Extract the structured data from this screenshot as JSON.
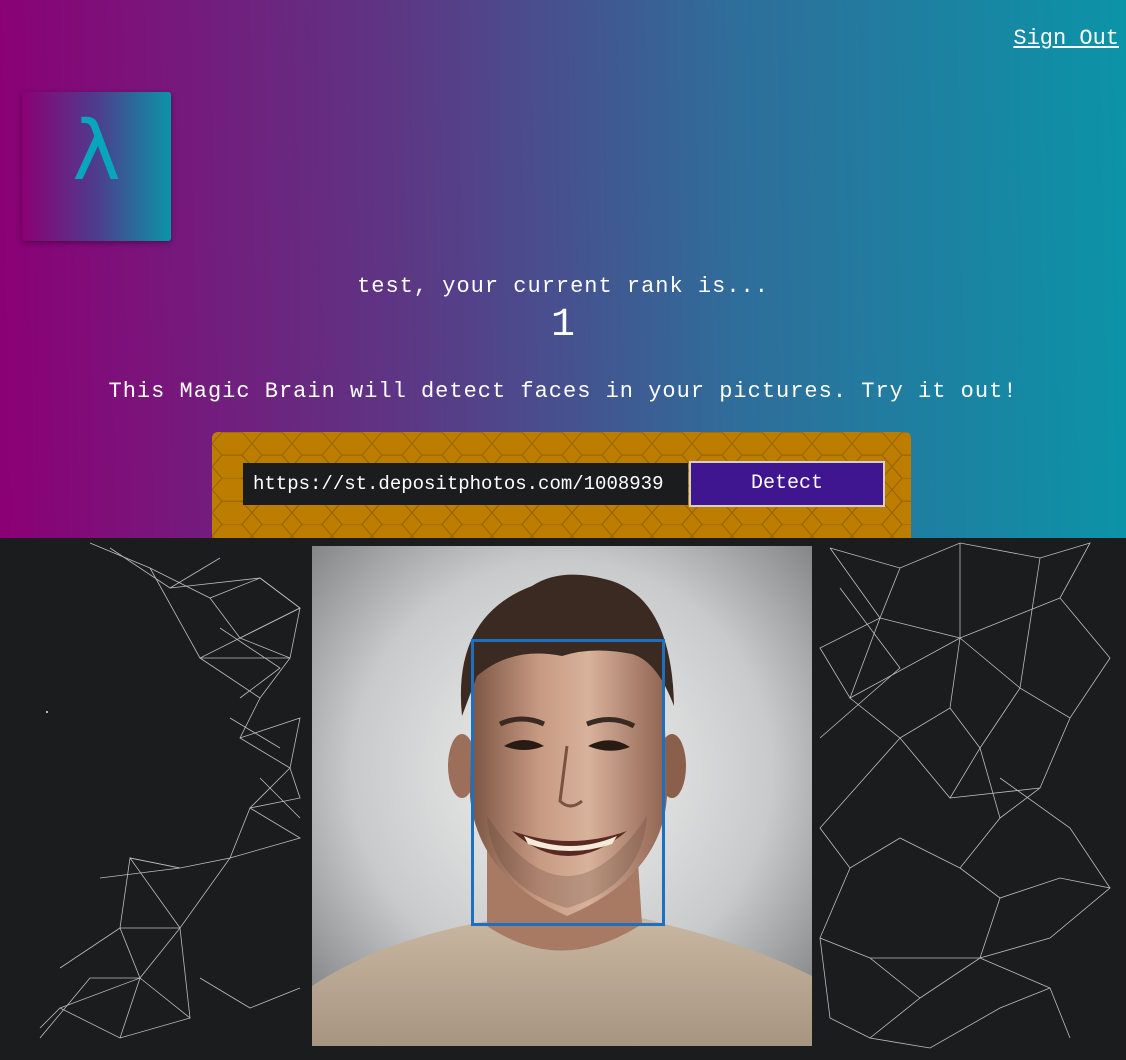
{
  "header": {
    "signout_label": "Sign Out",
    "logo_glyph": "λ",
    "logo_icon": "lambda-logo-icon"
  },
  "rank": {
    "message": "test, your current rank is...",
    "value": "1"
  },
  "intro": {
    "text": "This Magic Brain will detect faces in your pictures. Try it out!"
  },
  "form": {
    "url_value": "https://st.depositphotos.com/1008939",
    "detect_label": "Detect"
  },
  "result": {
    "image_subject": "smiling-man-portrait",
    "face_box_color": "#1e6fc0"
  },
  "colors": {
    "gradient_left": "#8b0075",
    "gradient_right": "#0b94a8",
    "panel": "#bd7e00",
    "button": "#3f168f",
    "background": "#1b1c1e"
  }
}
